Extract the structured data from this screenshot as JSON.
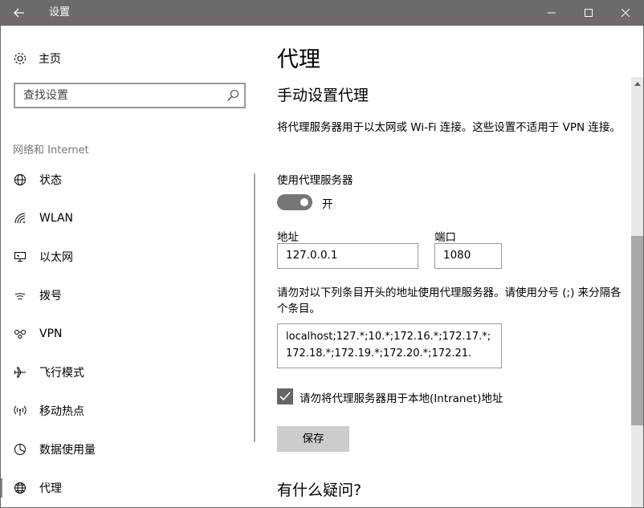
{
  "window": {
    "title": "设置"
  },
  "nav": {
    "home_label": "主页",
    "search_placeholder": "查找设置",
    "section_label": "网络和 Internet",
    "items": [
      {
        "label": "状态",
        "icon": "globe-status-icon"
      },
      {
        "label": "WLAN",
        "icon": "wifi-icon"
      },
      {
        "label": "以太网",
        "icon": "ethernet-icon"
      },
      {
        "label": "拨号",
        "icon": "dialup-icon"
      },
      {
        "label": "VPN",
        "icon": "vpn-icon"
      },
      {
        "label": "飞行模式",
        "icon": "airplane-icon"
      },
      {
        "label": "移动热点",
        "icon": "hotspot-icon"
      },
      {
        "label": "数据使用量",
        "icon": "pie-chart-icon"
      },
      {
        "label": "代理",
        "icon": "globe-icon",
        "selected": true
      }
    ]
  },
  "content": {
    "page_title": "代理",
    "section_title": "手动设置代理",
    "description": "将代理服务器用于以太网或 Wi-Fi 连接。这些设置不适用于 VPN 连接。",
    "use_proxy_label": "使用代理服务器",
    "toggle_state": "开",
    "toggle_on": true,
    "address_label": "地址",
    "address_value": "127.0.0.1",
    "port_label": "端口",
    "port_value": "1080",
    "exceptions_description": "请勿对以下列条目开头的地址使用代理服务器。请使用分号 (;) 来分隔各个条目。",
    "exceptions_value": "localhost;127.*;10.*;172.16.*;172.17.*;172.18.*;172.19.*;172.20.*;172.21.",
    "bypass_local_label": "请勿将代理服务器用于本地(Intranet)地址",
    "bypass_local_checked": true,
    "save_label": "保存",
    "faq_title": "有什么疑问?"
  },
  "colors": {
    "titlebar": "#6e6a6b",
    "toggle": "#767676",
    "button": "#cccccc"
  }
}
